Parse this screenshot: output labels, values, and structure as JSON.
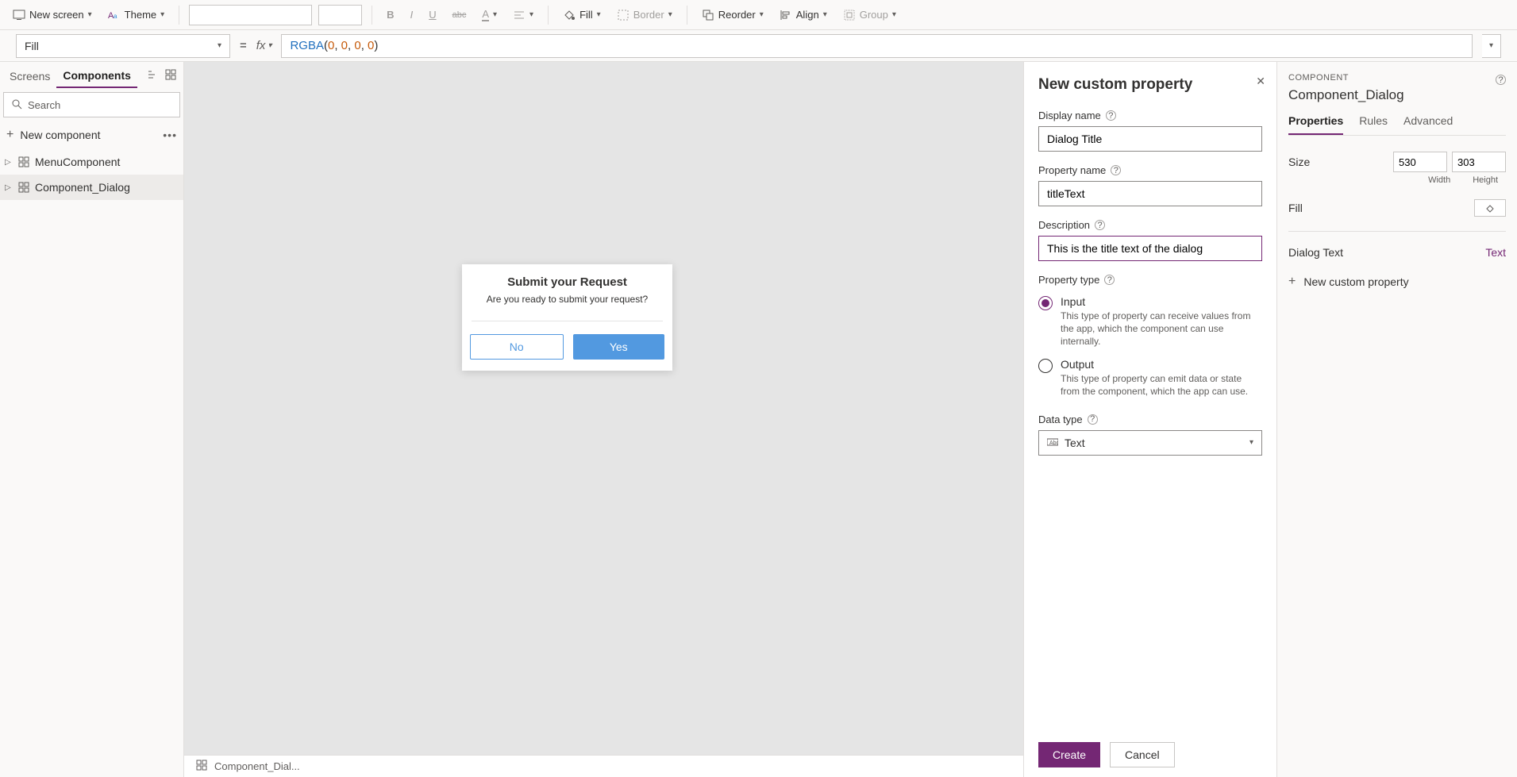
{
  "toolbar": {
    "new_screen": "New screen",
    "theme": "Theme",
    "fill": "Fill",
    "border": "Border",
    "reorder": "Reorder",
    "align": "Align",
    "group": "Group"
  },
  "formula": {
    "property": "Fill",
    "fn": "RGBA",
    "args": [
      "0",
      "0",
      "0",
      "0"
    ]
  },
  "leftPanel": {
    "tabs": {
      "screens": "Screens",
      "components": "Components"
    },
    "search_placeholder": "Search",
    "new_component": "New component",
    "items": [
      {
        "label": "MenuComponent"
      },
      {
        "label": "Component_Dialog"
      }
    ]
  },
  "canvas": {
    "dialog": {
      "title": "Submit your Request",
      "message": "Are you ready to submit your request?",
      "no": "No",
      "yes": "Yes"
    }
  },
  "statusbar": {
    "breadcrumb": "Component_Dial..."
  },
  "propertyPanel": {
    "title": "New custom property",
    "display_name_label": "Display name",
    "display_name_value": "Dialog Title",
    "property_name_label": "Property name",
    "property_name_value": "titleText",
    "description_label": "Description",
    "description_value": "This is the title text of the dialog",
    "property_type_label": "Property type",
    "input_label": "Input",
    "input_desc": "This type of property can receive values from the app, which the component can use internally.",
    "output_label": "Output",
    "output_desc": "This type of property can emit data or state from the component, which the app can use.",
    "data_type_label": "Data type",
    "data_type_value": "Text",
    "create": "Create",
    "cancel": "Cancel"
  },
  "rightPanel": {
    "section": "COMPONENT",
    "name": "Component_Dialog",
    "tabs": {
      "properties": "Properties",
      "rules": "Rules",
      "advanced": "Advanced"
    },
    "size_label": "Size",
    "width": "530",
    "height": "303",
    "width_lbl": "Width",
    "height_lbl": "Height",
    "fill_label": "Fill",
    "dialog_text_label": "Dialog Text",
    "dialog_text_type": "Text",
    "new_custom_property": "New custom property"
  }
}
